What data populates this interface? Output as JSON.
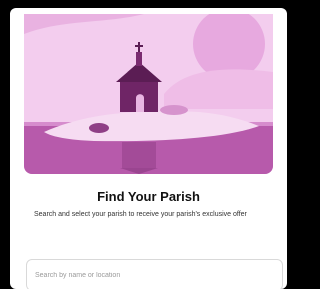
{
  "hero": {
    "illustration": "church-on-island-illustration",
    "accent_color": "#b34fa8",
    "sky_color": "#f1c6ea"
  },
  "main": {
    "title": "Find Your Parish",
    "subtitle": "Search and select your parish to receive your parish's exclusive offer"
  },
  "search": {
    "placeholder": "Search by name or location",
    "value": ""
  }
}
